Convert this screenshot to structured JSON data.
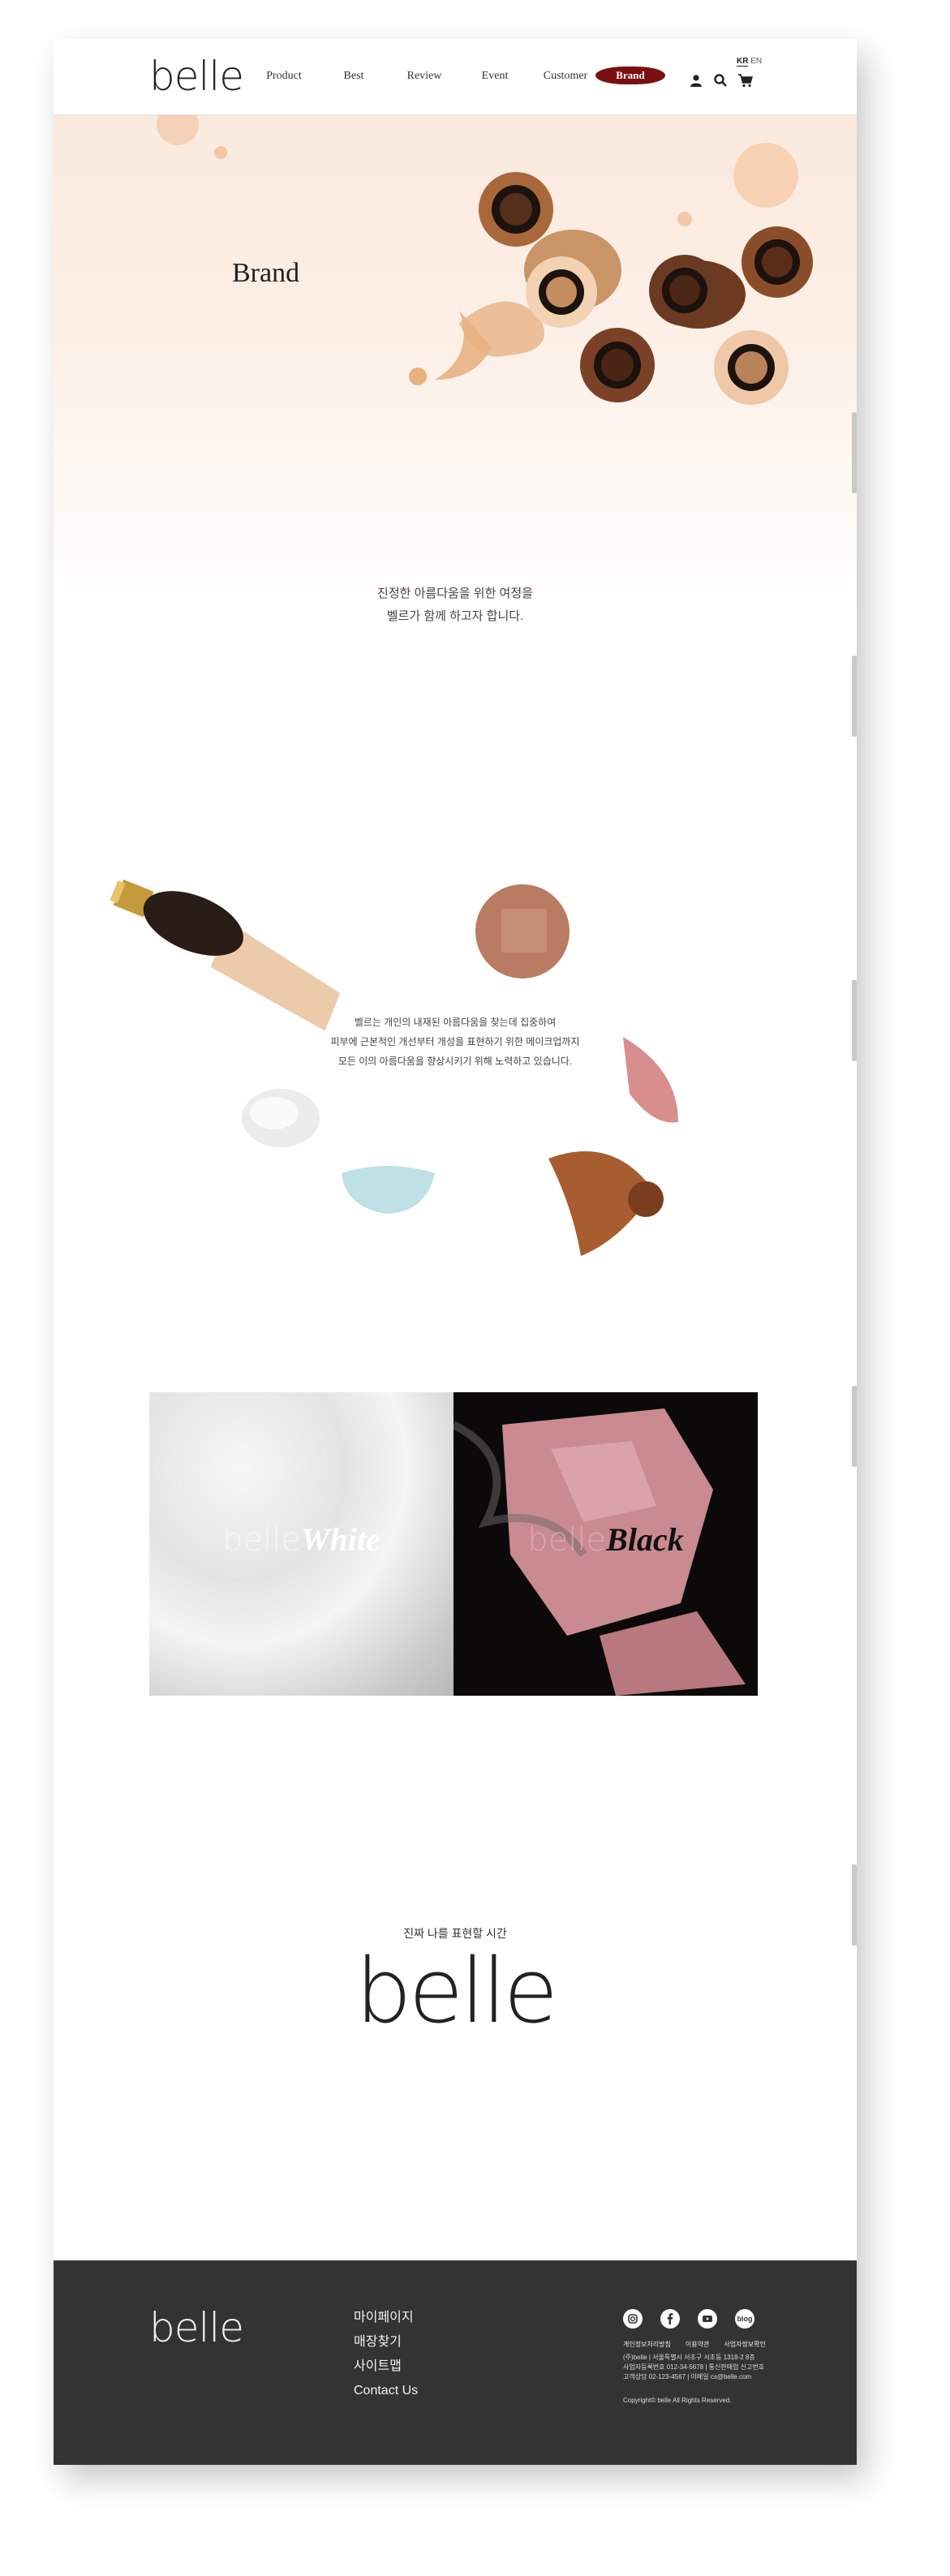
{
  "header": {
    "logo": "belle",
    "nav": [
      "Product",
      "Best",
      "Review",
      "Event",
      "Customer"
    ],
    "brand_button": "Brand",
    "lang": {
      "ko": "KR",
      "en": "EN"
    }
  },
  "hero": {
    "title": "Brand",
    "text_line1": "진정한 아름다움을 위한 여정을",
    "text_line2": "벨르가 함께 하고자 합니다."
  },
  "cosmetics": {
    "line1": "벨르는 개인의 내재된 아름다움을 찾는데 집중하여",
    "line2": "피부에 근본적인 개선부터 개성을 표현하기 위한 메이크업까지",
    "line3": "모든 이의 아름다움을 향상시키기 위해 노력하고 있습니다."
  },
  "lines": {
    "white": {
      "prefix": "belle",
      "name": "White"
    },
    "black": {
      "prefix": "belle",
      "name": "Black"
    }
  },
  "closing": {
    "tagline": "진짜 나를 표현할 시간",
    "logo": "belle"
  },
  "footer": {
    "logo": "belle",
    "menu": [
      "마이페이지",
      "매장찾기",
      "사이트맵",
      "Contact Us"
    ],
    "social": [
      "instagram-icon",
      "facebook-icon",
      "youtube-icon",
      "blog-icon"
    ],
    "blog_label": "blog",
    "links": [
      "개인정보처리방침",
      "이용약관",
      "사업자정보확인"
    ],
    "info_line1": "(주)belle  |  서울특별시 서초구 서초동 1318-2 8층",
    "info_line2": "사업자등록번호 012-34-5678  |  통신판매업 신고번호",
    "info_line3": "고객상담 02-123-4567  |  이메일 cs@belle.com",
    "copyright": "Copyright© belle All Rights Reserved."
  },
  "colors": {
    "brand_pill": "#7a0f12",
    "footer_bg": "#333333",
    "hero_bg": "#fbe9dd"
  }
}
